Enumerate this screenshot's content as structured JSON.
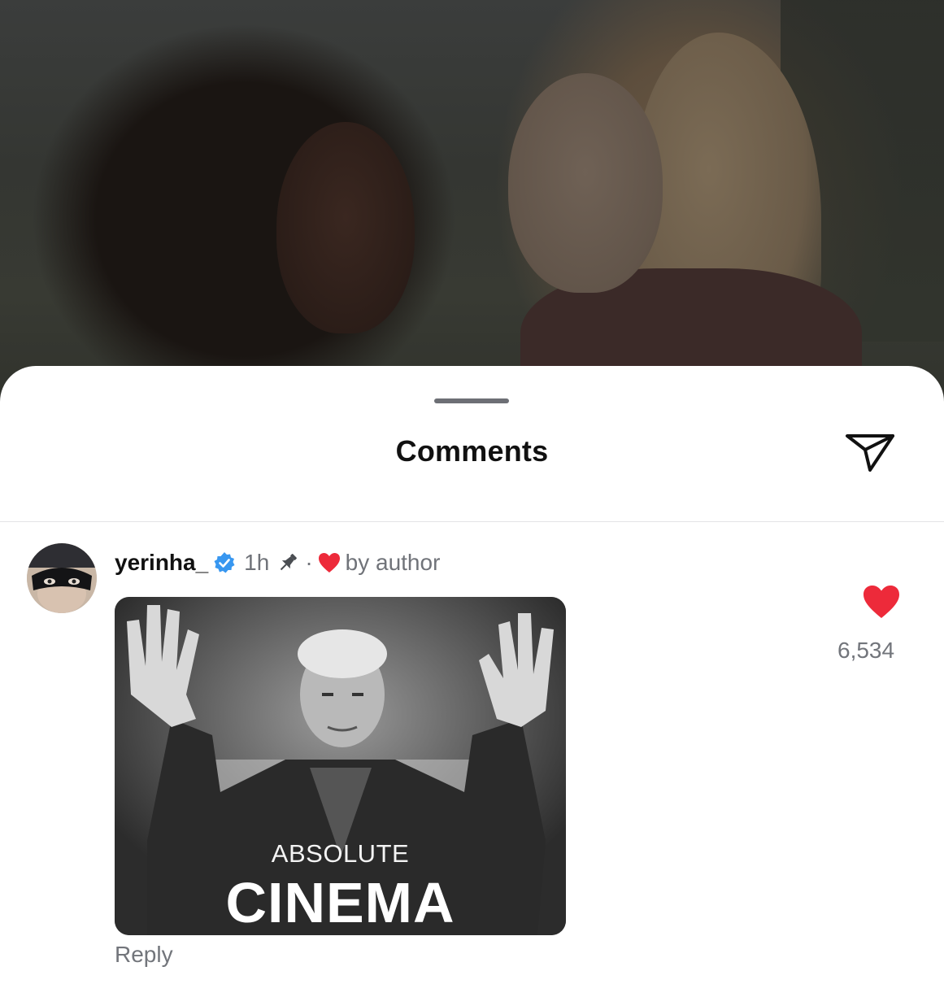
{
  "sheet": {
    "title": "Comments",
    "share_icon": "share-paper-plane-icon"
  },
  "comment": {
    "username": "yerinha_",
    "verified_icon": "verified-badge-icon",
    "time": "1h",
    "pin_icon": "pin-icon",
    "separator": "·",
    "liked_by_author_icon": "heart-icon",
    "liked_by_author_text": "by author",
    "gif": {
      "top_text": "ABSOLUTE",
      "bottom_text": "CINEMA"
    },
    "reply_label": "Reply",
    "like_icon": "heart-filled-icon",
    "like_count": "6,534"
  },
  "colors": {
    "heart": "#ed2a3a",
    "verified": "#3897f0",
    "secondary_text": "#72757b"
  }
}
